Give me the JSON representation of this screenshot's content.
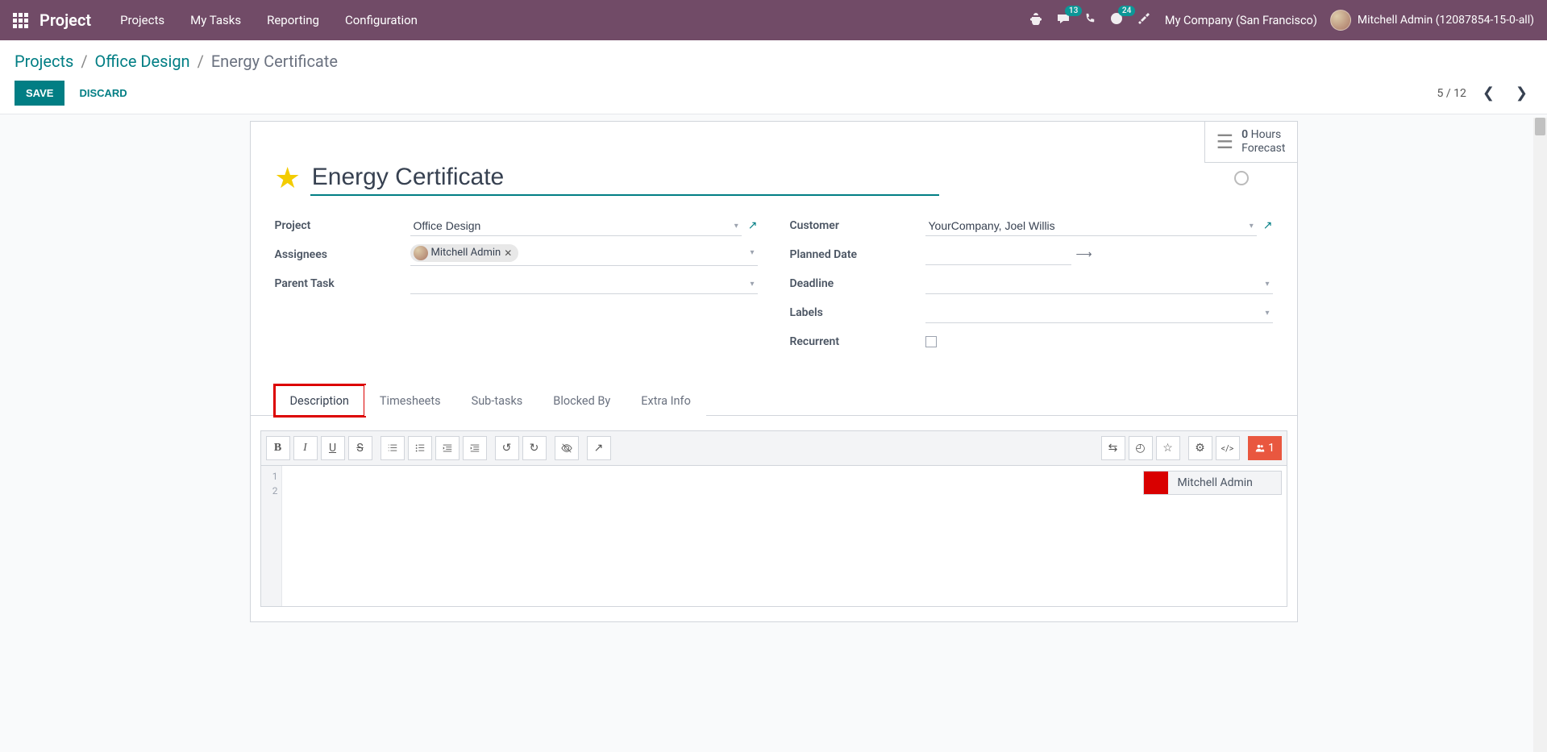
{
  "navbar": {
    "brand": "Project",
    "links": [
      "Projects",
      "My Tasks",
      "Reporting",
      "Configuration"
    ],
    "msg_badge": "13",
    "activity_badge": "24",
    "company": "My Company (San Francisco)",
    "user": "Mitchell Admin (12087854-15-0-all)"
  },
  "breadcrumb": {
    "root": "Projects",
    "parent": "Office Design",
    "current": "Energy Certificate"
  },
  "buttons": {
    "save": "SAVE",
    "discard": "DISCARD"
  },
  "pager": {
    "text": "5 / 12"
  },
  "statbox": {
    "count": "0",
    "unit": "Hours",
    "sub": "Forecast"
  },
  "task": {
    "title": "Energy Certificate",
    "project_label": "Project",
    "project_value": "Office Design",
    "assignees_label": "Assignees",
    "assignee_name": "Mitchell Admin",
    "parent_label": "Parent Task",
    "parent_value": "",
    "customer_label": "Customer",
    "customer_value": "YourCompany, Joel Willis",
    "planned_label": "Planned Date",
    "deadline_label": "Deadline",
    "deadline_value": "",
    "labels_label": "Labels",
    "labels_value": "",
    "recurrent_label": "Recurrent"
  },
  "tabs": [
    "Description",
    "Timesheets",
    "Sub-tasks",
    "Blocked By",
    "Extra Info"
  ],
  "editor": {
    "lines": [
      "1",
      "2"
    ],
    "collab_user": "Mitchell Admin",
    "collab_count": "1"
  }
}
